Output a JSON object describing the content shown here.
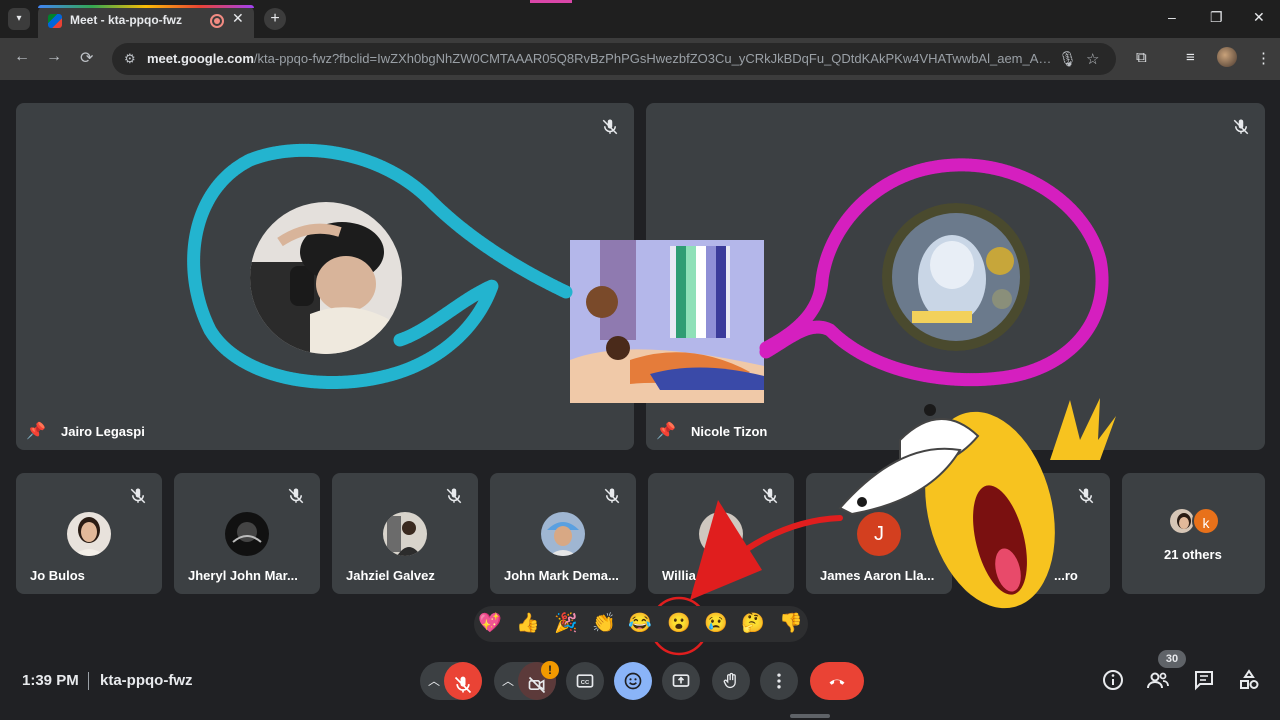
{
  "browser": {
    "tab_title": "Meet - kta-ppqo-fwz",
    "tab_close": "✕",
    "new_tab": "+",
    "url_host": "meet.google.com",
    "url_rest": "/kta-ppqo-fwz?fbclid=IwZXh0bgNhZW0CMTAAAR05Q8RvBzPhPGsHwezbfZO3Cu_yCRkJkBDqFu_QDtdKAkPKw4VHATwwbAl_aem_AZOpK...",
    "minimize": "–",
    "maximize": "❐",
    "close": "✕"
  },
  "stage": {
    "main_tiles": [
      {
        "name": "Jairo Legaspi"
      },
      {
        "name": "Nicole Tizon"
      }
    ],
    "thumb_tiles": [
      {
        "name": "Jo Bulos"
      },
      {
        "name": "Jheryl John Mar..."
      },
      {
        "name": "Jahziel Galvez"
      },
      {
        "name": "John Mark Dema..."
      },
      {
        "name": "Willia...d"
      },
      {
        "name": "James Aaron Lla...",
        "initial": "J"
      },
      {
        "name": "...ro"
      }
    ],
    "others": {
      "label": "21 others",
      "initial": "k"
    }
  },
  "reactions": [
    "💖",
    "👍",
    "🎉",
    "👏",
    "😂",
    "😮",
    "😢",
    "🤔",
    "👎"
  ],
  "bottom": {
    "time": "1:39 PM",
    "meeting_code": "kta-ppqo-fwz",
    "warning_badge": "!",
    "people_count": "30"
  },
  "colors": {
    "accent_blue": "#8ab4f8",
    "mic_off_red": "#ea4335",
    "hangup_red": "#ea4335",
    "tile_bg": "#3c4043"
  }
}
